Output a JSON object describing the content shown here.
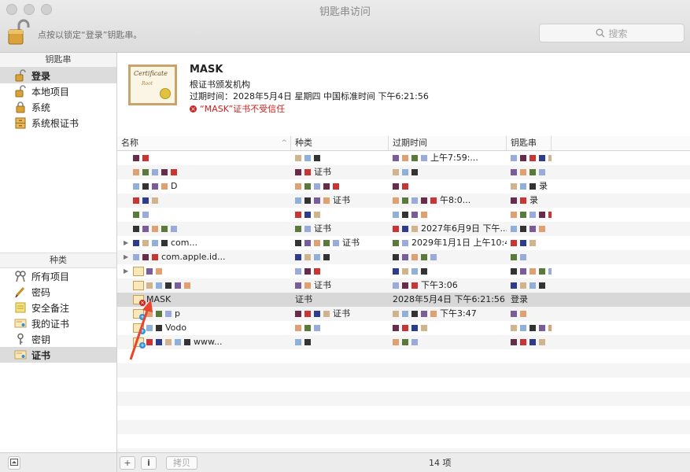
{
  "window": {
    "title": "钥匙串访问"
  },
  "toolbar": {
    "lock_hint": "点按以锁定“登录”钥匙串。",
    "search_placeholder": "搜索"
  },
  "sidebar": {
    "keychains_header": "钥匙串",
    "keychains": [
      {
        "label": "登录",
        "icon": "lock-open-icon",
        "selected": true
      },
      {
        "label": "本地项目",
        "icon": "lock-open-icon",
        "selected": false
      },
      {
        "label": "系统",
        "icon": "lock-icon",
        "selected": false
      },
      {
        "label": "系统根证书",
        "icon": "cabinet-icon",
        "selected": false
      }
    ],
    "categories_header": "种类",
    "categories": [
      {
        "label": "所有项目",
        "icon": "all-items-icon",
        "selected": false
      },
      {
        "label": "密码",
        "icon": "pencil-icon",
        "selected": false
      },
      {
        "label": "安全备注",
        "icon": "note-icon",
        "selected": false
      },
      {
        "label": "我的证书",
        "icon": "certificate-icon",
        "selected": false
      },
      {
        "label": "密钥",
        "icon": "key-icon",
        "selected": false
      },
      {
        "label": "证书",
        "icon": "certificate-icon",
        "selected": true
      }
    ]
  },
  "details": {
    "cert_art_title": "Certificate",
    "cert_art_sub": "Root",
    "name": "MASK",
    "subtitle": "根证书颁发机构",
    "expiry": "过期时间：2028年5月4日 星期四 中国标准时间 下午6:21:56",
    "warning": "“MASK”证书不受信任"
  },
  "table": {
    "headers": {
      "name": "名称",
      "kind": "种类",
      "expires": "过期时间",
      "keychain": "钥匙串"
    },
    "rows": [
      {
        "name": "",
        "kind": "",
        "expires": "上午7:59:...",
        "keychain": "",
        "icon": "none"
      },
      {
        "name": "",
        "kind": "证书",
        "expires": "",
        "keychain": "",
        "icon": "none"
      },
      {
        "name": "D",
        "kind": "",
        "expires": "",
        "keychain": "录",
        "icon": "none"
      },
      {
        "name": "",
        "kind": "证书",
        "expires": "午8:0...",
        "keychain": "录",
        "icon": "none"
      },
      {
        "name": "",
        "kind": "",
        "expires": "",
        "keychain": "录",
        "icon": "none"
      },
      {
        "name": "",
        "kind": "证书",
        "expires": "2027年6月9日 下午...",
        "keychain": "",
        "icon": "none"
      },
      {
        "name": "com...",
        "kind": "证书",
        "expires": "2029年1月1日 上午10:42:...",
        "keychain": "",
        "icon": "none",
        "expandable": true
      },
      {
        "name": "com.apple.id...",
        "kind": "",
        "expires": "",
        "keychain": "",
        "icon": "none",
        "expandable": true
      },
      {
        "name": "",
        "kind": "",
        "expires": "",
        "keychain": "",
        "icon": "cert",
        "expandable": true
      },
      {
        "name": "",
        "kind": "证书",
        "expires": "下午3:06",
        "keychain": "",
        "icon": "cert"
      },
      {
        "name": "MASK",
        "kind": "证书",
        "expires": "2028年5月4日 下午6:21:56",
        "keychain": "登录",
        "icon": "cert-red",
        "selected": true
      },
      {
        "name": "p",
        "kind": "证书",
        "expires": "下午3:47",
        "keychain": "",
        "icon": "cert-blue"
      },
      {
        "name": "Vodo",
        "kind": "",
        "expires": "",
        "keychain": "",
        "icon": "cert-blue"
      },
      {
        "name": "www...",
        "kind": "",
        "expires": "",
        "keychain": "",
        "icon": "cert-blue"
      }
    ]
  },
  "bottombar": {
    "add_label": "+",
    "info_label": "i",
    "copy_label": "拷贝",
    "count": "14 项"
  },
  "colors": {
    "error": "#d0211c",
    "selection": "#d8d8d8",
    "annotation_arrow": "#e8452c"
  }
}
